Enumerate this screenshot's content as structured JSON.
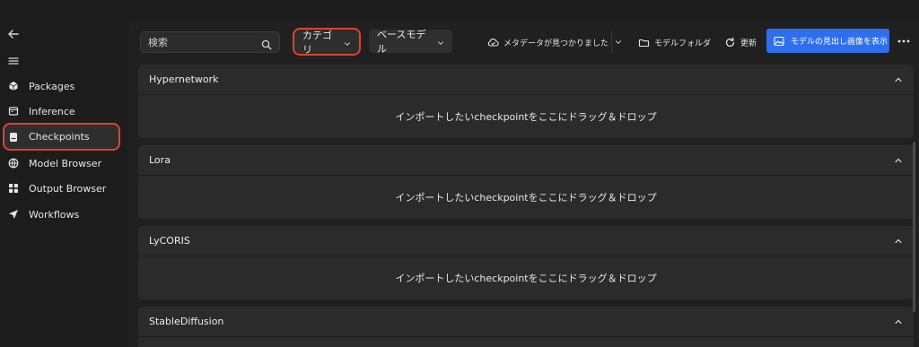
{
  "sidebar": {
    "items": [
      {
        "label": "Packages",
        "icon": "package-icon"
      },
      {
        "label": "Inference",
        "icon": "inference-icon"
      },
      {
        "label": "Checkpoints",
        "icon": "checkpoints-icon",
        "active": true
      },
      {
        "label": "Model Browser",
        "icon": "model-browser-icon"
      },
      {
        "label": "Output Browser",
        "icon": "output-browser-icon"
      },
      {
        "label": "Workflows",
        "icon": "workflows-icon"
      }
    ]
  },
  "toolbar": {
    "search_placeholder": "検索",
    "category_label": "カテゴリ",
    "base_model_label": "ベースモデル",
    "metadata_label": "メタデータが見つかりました",
    "model_folder_label": "モデルフォルダ",
    "refresh_label": "更新",
    "preview_label": "モデルの見出し画像を表示"
  },
  "sections": [
    {
      "title": "Hypernetwork",
      "drop_text": "インポートしたいcheckpointをここにドラッグ＆ドロップ"
    },
    {
      "title": "Lora",
      "drop_text": "インポートしたいcheckpointをここにドラッグ＆ドロップ"
    },
    {
      "title": "LyCORIS",
      "drop_text": "インポートしたいcheckpointをここにドラッグ＆ドロップ"
    },
    {
      "title": "StableDiffusion",
      "drop_text": ""
    }
  ],
  "colors": {
    "accent_blue": "#2f6fed",
    "highlight_red": "#e4402b",
    "background": "#1c1c1c",
    "panel": "#2b2b2b"
  }
}
